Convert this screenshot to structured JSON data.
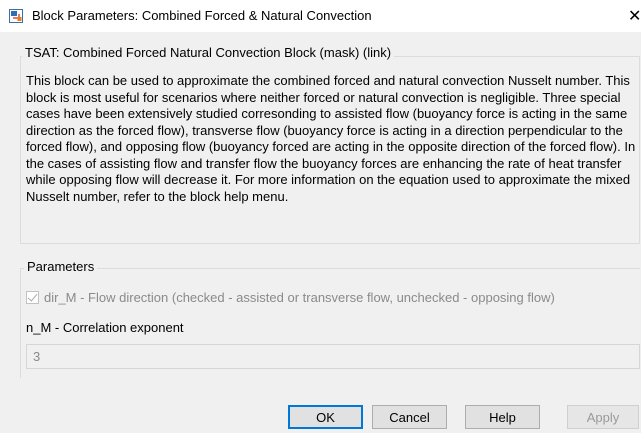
{
  "window": {
    "title": "Block Parameters: Combined Forced & Natural Convection",
    "icon": "simulink-block-icon",
    "close_glyph": "✕"
  },
  "mask_group": {
    "label": "TSAT: Combined Forced  Natural Convection Block (mask) (link)",
    "description": "This block can be used to approximate the combined forced and natural convection Nusselt number. This block is most useful for scenarios where neither forced or natural convection is negligible. Three special cases have been extensively studied corresonding to assisted flow (buoyancy force is acting in the same direction as the forced flow), transverse flow (buoyancy force is acting in a direction perpendicular to the forced flow), and opposing flow (buoyancy forced are acting in the opposite direction of the forced flow). In the cases of assisting flow and transfer flow the buoyancy forces are enhancing the rate of heat transfer while opposing flow will decrease it. For more information on the equation used to approximate the mixed Nusselt number, refer to the block help menu."
  },
  "parameters": {
    "label": "Parameters",
    "flow_direction": {
      "label": "dir_M - Flow direction (checked - assisted or transverse flow, unchecked - opposing flow)",
      "checked": true,
      "enabled": false
    },
    "correlation_exponent": {
      "label": "n_M - Correlation exponent",
      "value": "3",
      "enabled": false
    }
  },
  "buttons": {
    "ok": "OK",
    "cancel": "Cancel",
    "help": "Help",
    "apply": "Apply"
  }
}
